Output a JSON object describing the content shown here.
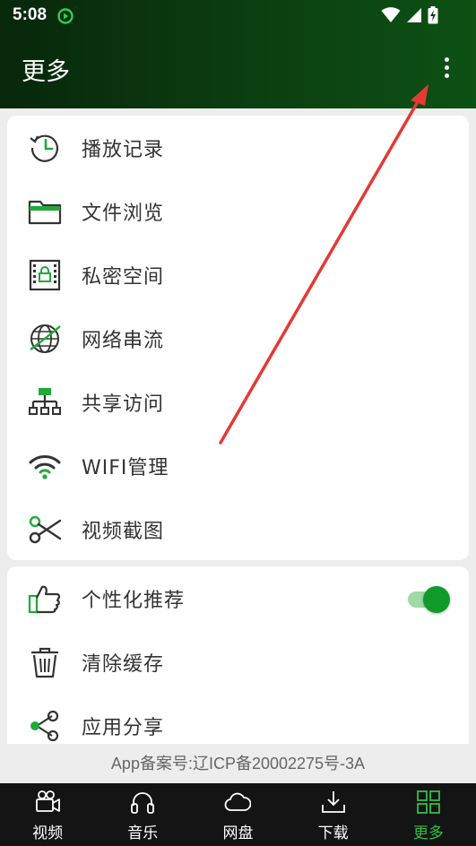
{
  "status_bar": {
    "time": "5:08"
  },
  "header": {
    "title": "更多"
  },
  "menu_main": [
    {
      "icon": "history-clock-icon",
      "label": "播放记录"
    },
    {
      "icon": "folder-icon",
      "label": "文件浏览"
    },
    {
      "icon": "private-lock-icon",
      "label": "私密空间"
    },
    {
      "icon": "globe-icon",
      "label": "网络串流"
    },
    {
      "icon": "network-tree-icon",
      "label": "共享访问"
    },
    {
      "icon": "wifi-icon",
      "label": "WIFI管理"
    },
    {
      "icon": "scissors-icon",
      "label": "视频截图"
    }
  ],
  "menu_settings": [
    {
      "icon": "thumbs-up-icon",
      "label": "个性化推荐",
      "toggle": true
    },
    {
      "icon": "trash-icon",
      "label": "清除缓存"
    },
    {
      "icon": "share-icon",
      "label": "应用分享"
    }
  ],
  "footer": {
    "icp": "App备案号:辽ICP备20002275号-3A"
  },
  "bottom_nav": [
    {
      "icon": "video-camera-icon",
      "label": "视频",
      "active": false
    },
    {
      "icon": "headphones-icon",
      "label": "音乐",
      "active": false
    },
    {
      "icon": "cloud-icon",
      "label": "网盘",
      "active": false
    },
    {
      "icon": "download-icon",
      "label": "下载",
      "active": false
    },
    {
      "icon": "grid-icon",
      "label": "更多",
      "active": true
    }
  ],
  "colors": {
    "accent": "#0f9a2a",
    "header_dark": "#08270b",
    "annotation": "#e53935"
  }
}
